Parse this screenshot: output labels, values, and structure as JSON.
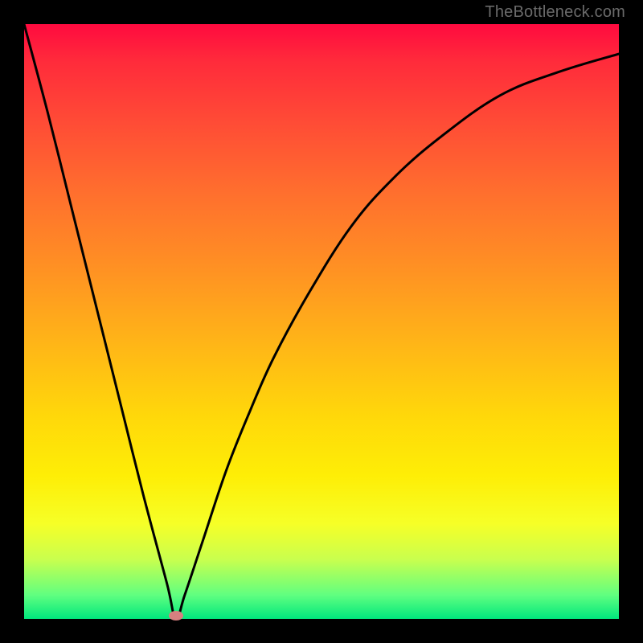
{
  "watermark": "TheBottleneck.com",
  "chart_data": {
    "type": "line",
    "title": "",
    "xlabel": "",
    "ylabel": "",
    "xlim": [
      0,
      100
    ],
    "ylim": [
      0,
      100
    ],
    "grid": false,
    "legend": false,
    "background_gradient": {
      "orientation": "vertical",
      "stops": [
        {
          "pos": 0.0,
          "color": "#ff0a3f"
        },
        {
          "pos": 0.16,
          "color": "#ff4a36"
        },
        {
          "pos": 0.4,
          "color": "#ff8e24"
        },
        {
          "pos": 0.66,
          "color": "#ffd80a"
        },
        {
          "pos": 0.84,
          "color": "#f6ff27"
        },
        {
          "pos": 0.96,
          "color": "#60ff80"
        },
        {
          "pos": 1.0,
          "color": "#00e77d"
        }
      ]
    },
    "series": [
      {
        "name": "curve",
        "color": "#000000",
        "x": [
          0,
          4,
          8,
          12,
          16,
          20,
          24,
          25.5,
          27,
          30,
          34,
          38,
          42,
          48,
          55,
          62,
          70,
          80,
          90,
          100
        ],
        "y": [
          100,
          85,
          69,
          53,
          37,
          21,
          6,
          0,
          4,
          13,
          25,
          35,
          44,
          55,
          66,
          74,
          81,
          88,
          92,
          95
        ]
      }
    ],
    "marker": {
      "x": 25.5,
      "y": 0.5,
      "color": "#d88080"
    }
  }
}
